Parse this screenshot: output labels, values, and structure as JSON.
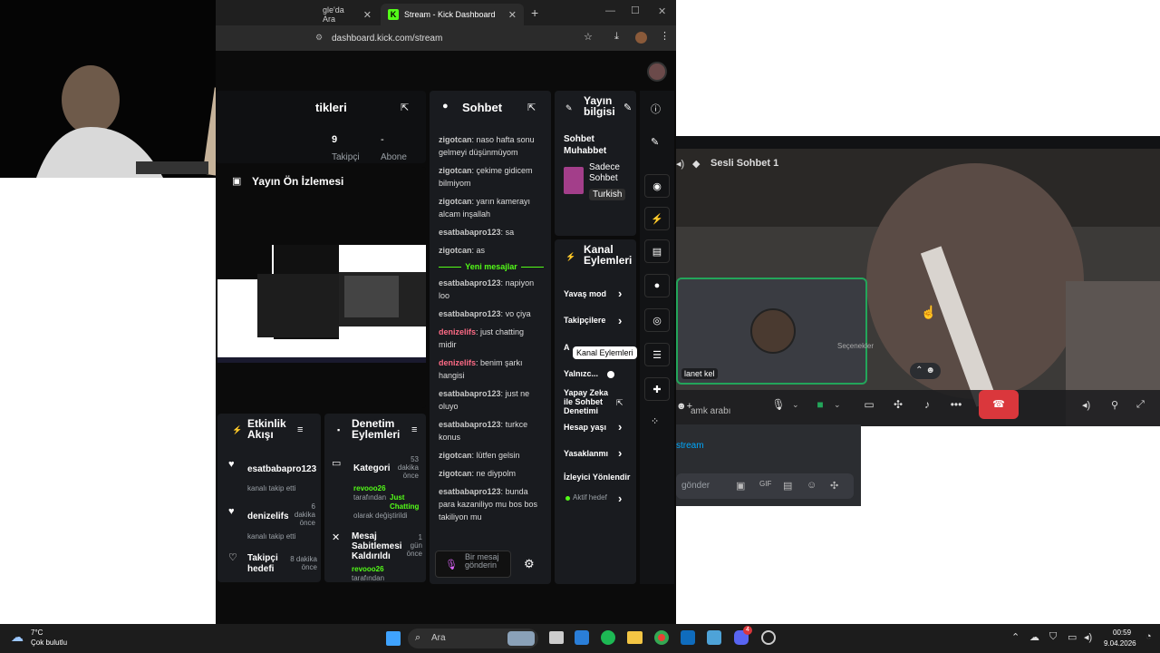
{
  "browser": {
    "tabs": [
      {
        "label": "gle'da Ara"
      },
      {
        "label": "Stream - Kick Dashboard"
      }
    ],
    "url": "dashboard.kick.com/stream"
  },
  "stats": {
    "title": "tikleri",
    "followers_value": "9",
    "followers_label": "Takipçi",
    "subs_value": "-",
    "subs_label": "Abone"
  },
  "preview": {
    "title": "Yayın Ön İzlemesi"
  },
  "chat": {
    "title": "Sohbet",
    "messages": [
      {
        "user": "zigotcan",
        "text": "naso hafta sonu gelmeyi düşünmüyom"
      },
      {
        "user": "zigotcan",
        "text": "çekime gidicem bilmiyom"
      },
      {
        "user": "zigotcan",
        "text": "yarın kamerayı alcam inşallah"
      },
      {
        "user": "esatbabapro123",
        "text": "sa"
      },
      {
        "user": "zigotcan",
        "text": "as"
      }
    ],
    "new_messages_label": "Yeni mesajlar",
    "new_messages": [
      {
        "user": "esatbabapro123",
        "text": "napiyon loo"
      },
      {
        "user": "esatbabapro123",
        "text": "vo çiya"
      },
      {
        "user": "denizelifs",
        "text": "just chatting midir"
      },
      {
        "user": "denizelifs",
        "text": "benim şarkı hangisi"
      },
      {
        "user": "esatbabapro123",
        "text": "just ne oluyo"
      },
      {
        "user": "esatbabapro123",
        "text": "turkce konus"
      },
      {
        "user": "zigotcan",
        "text": "lütfen gelsin"
      },
      {
        "user": "zigotcan",
        "text": "ne diypolm"
      },
      {
        "user": "esatbabapro123",
        "text": "bunda para kazaniliyo mu bos bos takiliyon mu"
      }
    ],
    "input_placeholder": "Bir mesaj gönderin"
  },
  "stream_info": {
    "title": "Yayın bilgisi",
    "stream_title": "Sohbet Muhabbet",
    "category": "Sadece Sohbet",
    "language": "Turkish"
  },
  "channel_actions": {
    "title": "Kanal Eylemleri",
    "items": [
      {
        "label": "Yavaş mod"
      },
      {
        "label": "Takipçilere"
      },
      {
        "label": "A"
      },
      {
        "label": "Yalnızc..."
      },
      {
        "label": "Yapay Zeka ile Sohbet Denetimi"
      },
      {
        "label": "Hesap yaşı"
      },
      {
        "label": "Yasaklanmı"
      },
      {
        "label": "İzleyici Yönlendir"
      },
      {
        "label": "Aktif hedef"
      }
    ],
    "tooltip": "Kanal Eylemleri"
  },
  "activity": {
    "title": "Etkinlik Akışı",
    "items": [
      {
        "user": "esatbabapro123",
        "sub": "kanalı takip etti",
        "time": ""
      },
      {
        "user": "denizelifs",
        "sub": "kanalı takip etti",
        "time": "6 dakika önce"
      },
      {
        "user": "Takipçi hedefi",
        "sub": "",
        "time": "8 dakika önce"
      }
    ]
  },
  "moderation": {
    "title": "Denetim Eylemleri",
    "items": [
      {
        "title": "Kategori",
        "time": "53 dakika önce",
        "by": "revooo26",
        "line1": "tarafından",
        "hl": "Just Chatting",
        "line2": "olarak değiştirildi"
      },
      {
        "title": "Mesaj Sabitlemesi Kaldırıldı",
        "time": "1 gün önce",
        "by": "revooo26",
        "line1": "tarafından",
        "hl": "",
        "line2": ""
      }
    ]
  },
  "discord": {
    "channel": "Sesli Sohbet 1",
    "tile_name": "lanet kel",
    "options_label": "Seçenekler",
    "bottom_user": "amk arabı",
    "link_text": "stream",
    "send_placeholder": "gönder"
  },
  "taskbar": {
    "temp": "7°C",
    "weather": "Çok bulutlu",
    "search": "Ara",
    "time": "00:59",
    "date": "9.04.2026",
    "discord_badge": "4"
  },
  "colors": {
    "accent_green": "#53fc18",
    "discord_red": "#da373c",
    "kick_bg": "#0b0b0b"
  }
}
